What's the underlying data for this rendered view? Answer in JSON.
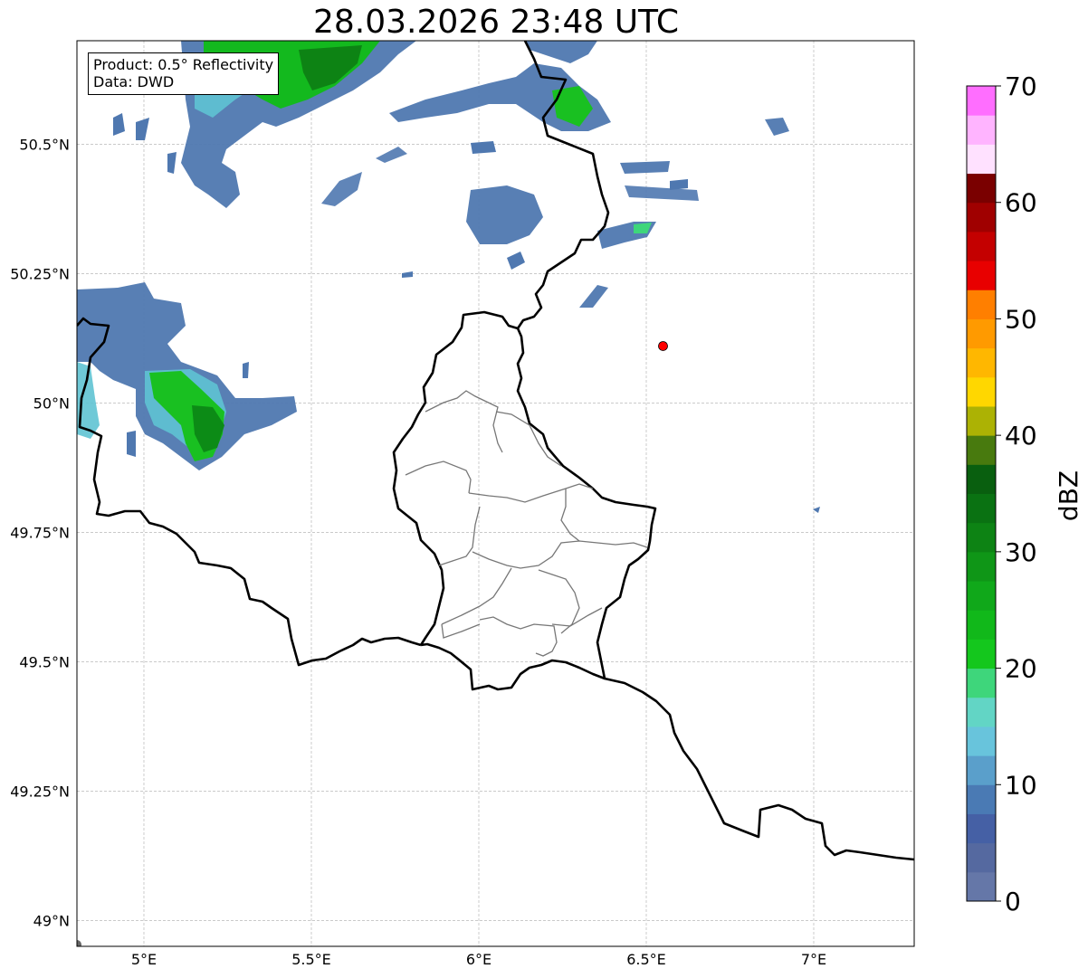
{
  "title": "28.03.2026 23:48 UTC",
  "info": {
    "product": "Product: 0.5° Reflectivity",
    "data_source": "Data: DWD"
  },
  "map": {
    "lon_range": [
      4.8,
      7.3
    ],
    "lat_range": [
      48.95,
      50.7
    ],
    "lon_ticks": [
      {
        "value": 5.0,
        "label": "5°E"
      },
      {
        "value": 5.5,
        "label": "5.5°E"
      },
      {
        "value": 6.0,
        "label": "6°E"
      },
      {
        "value": 6.5,
        "label": "6.5°E"
      },
      {
        "value": 7.0,
        "label": "7°E"
      }
    ],
    "lat_ticks": [
      {
        "value": 49.0,
        "label": "49°N"
      },
      {
        "value": 49.25,
        "label": "49.25°N"
      },
      {
        "value": 49.5,
        "label": "49.5°N"
      },
      {
        "value": 49.75,
        "label": "49.75°N"
      },
      {
        "value": 50.0,
        "label": "50°N"
      },
      {
        "value": 50.25,
        "label": "50.25°N"
      },
      {
        "value": 50.5,
        "label": "50.5°N"
      }
    ],
    "radar_site": {
      "lon": 6.55,
      "lat": 50.11,
      "color": "#ff0000"
    }
  },
  "colorbar": {
    "label": "dBZ",
    "min": 0,
    "max": 70,
    "step": 2.5,
    "tick_labels": [
      "0",
      "10",
      "20",
      "30",
      "40",
      "50",
      "60",
      "70"
    ],
    "colors": [
      "#6577a8",
      "#5569a0",
      "#4560a5",
      "#4a7ab4",
      "#5a9fcb",
      "#68c4dc",
      "#62d5c5",
      "#3ed67b",
      "#14c71d",
      "#11b81a",
      "#10a81a",
      "#0f9617",
      "#0d8314",
      "#0a7212",
      "#095f0f",
      "#487a0e",
      "#acb204",
      "#ffd700",
      "#ffb700",
      "#ff9a00",
      "#ff7f00",
      "#e80000",
      "#c40000",
      "#a00000",
      "#7a0000",
      "#ffe1ff",
      "#ffb4ff",
      "#ff6eff",
      "#ee3ced"
    ]
  }
}
